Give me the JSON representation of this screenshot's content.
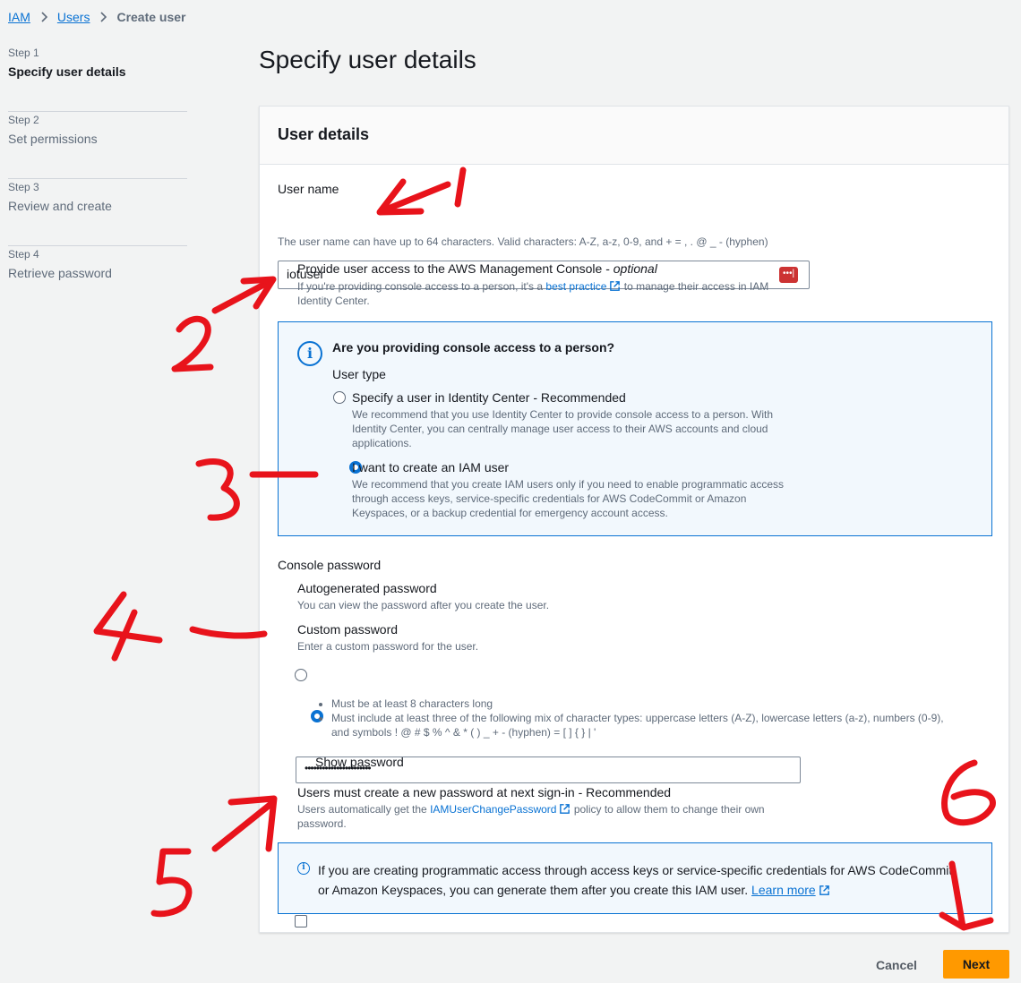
{
  "breadcrumb": {
    "iam": "IAM",
    "users": "Users",
    "current": "Create user"
  },
  "steps": [
    {
      "num": "Step 1",
      "title": "Specify user details"
    },
    {
      "num": "Step 2",
      "title": "Set permissions"
    },
    {
      "num": "Step 3",
      "title": "Review and create"
    },
    {
      "num": "Step 4",
      "title": "Retrieve password"
    }
  ],
  "page_title": "Specify user details",
  "panel": {
    "header": "User details",
    "username": {
      "label": "User name",
      "value": "iotuser",
      "hint": "The user name can have up to 64 characters. Valid characters: A-Z, a-z, 0-9, and + = , . @ _ - (hyphen)"
    },
    "console_access": {
      "label": "Provide user access to the AWS Management Console - ",
      "optional": "optional",
      "desc_pre": "If you're providing console access to a person, it's a ",
      "desc_link": "best practice",
      "desc_post": " to manage their access in IAM",
      "desc_line2": "Identity Center."
    },
    "person_box": {
      "title": "Are you providing console access to a person?",
      "user_type_label": "User type",
      "opt1_label": "Specify a user in Identity Center - Recommended",
      "opt1_desc1": "We recommend that you use Identity Center to provide console access to a person. With",
      "opt1_desc2": "Identity Center, you can centrally manage user access to their AWS accounts and cloud",
      "opt1_desc3": "applications.",
      "opt2_label": "I want to create an IAM user",
      "opt2_desc1": "We recommend that you create IAM users only if you need to enable programmatic access",
      "opt2_desc2": "through access keys, service-specific credentials for AWS CodeCommit or Amazon",
      "opt2_desc3": "Keyspaces, or a backup credential for emergency account access."
    },
    "console_password": {
      "label": "Console password",
      "auto_label": "Autogenerated password",
      "auto_desc": "You can view the password after you create the user.",
      "custom_label": "Custom password",
      "custom_desc": "Enter a custom password for the user.",
      "password_value": "•••••••••••••••••••••••",
      "req1": "Must be at least 8 characters long",
      "req2a": "Must include at least three of the following mix of character types: uppercase letters (A-Z), lowercase letters (a-z), numbers (0-9),",
      "req2b": "and symbols ! @ # $ % ^ & * ( ) _ + - (hyphen) = [ ] { } | '",
      "show_password": "Show password"
    },
    "new_password": {
      "label": "Users must create a new password at next sign-in - Recommended",
      "desc_pre": "Users automatically get the ",
      "desc_link": "IAMUserChangePassword",
      "desc_post": " policy to allow them to change their own",
      "desc_line2": "password."
    },
    "info_programmatic": {
      "line1": "If you are creating programmatic access through access keys or service-specific credentials for AWS CodeCommit",
      "line2_pre": "or Amazon Keyspaces, you can generate them after you create this IAM user. ",
      "link": "Learn more"
    }
  },
  "buttons": {
    "cancel": "Cancel",
    "next": "Next"
  },
  "annotations": [
    "1",
    "2",
    "3",
    "4",
    "5",
    "6"
  ],
  "colors": {
    "accent": "#0972d3",
    "next_button": "#ff9900",
    "annotation": "#e8131b"
  }
}
